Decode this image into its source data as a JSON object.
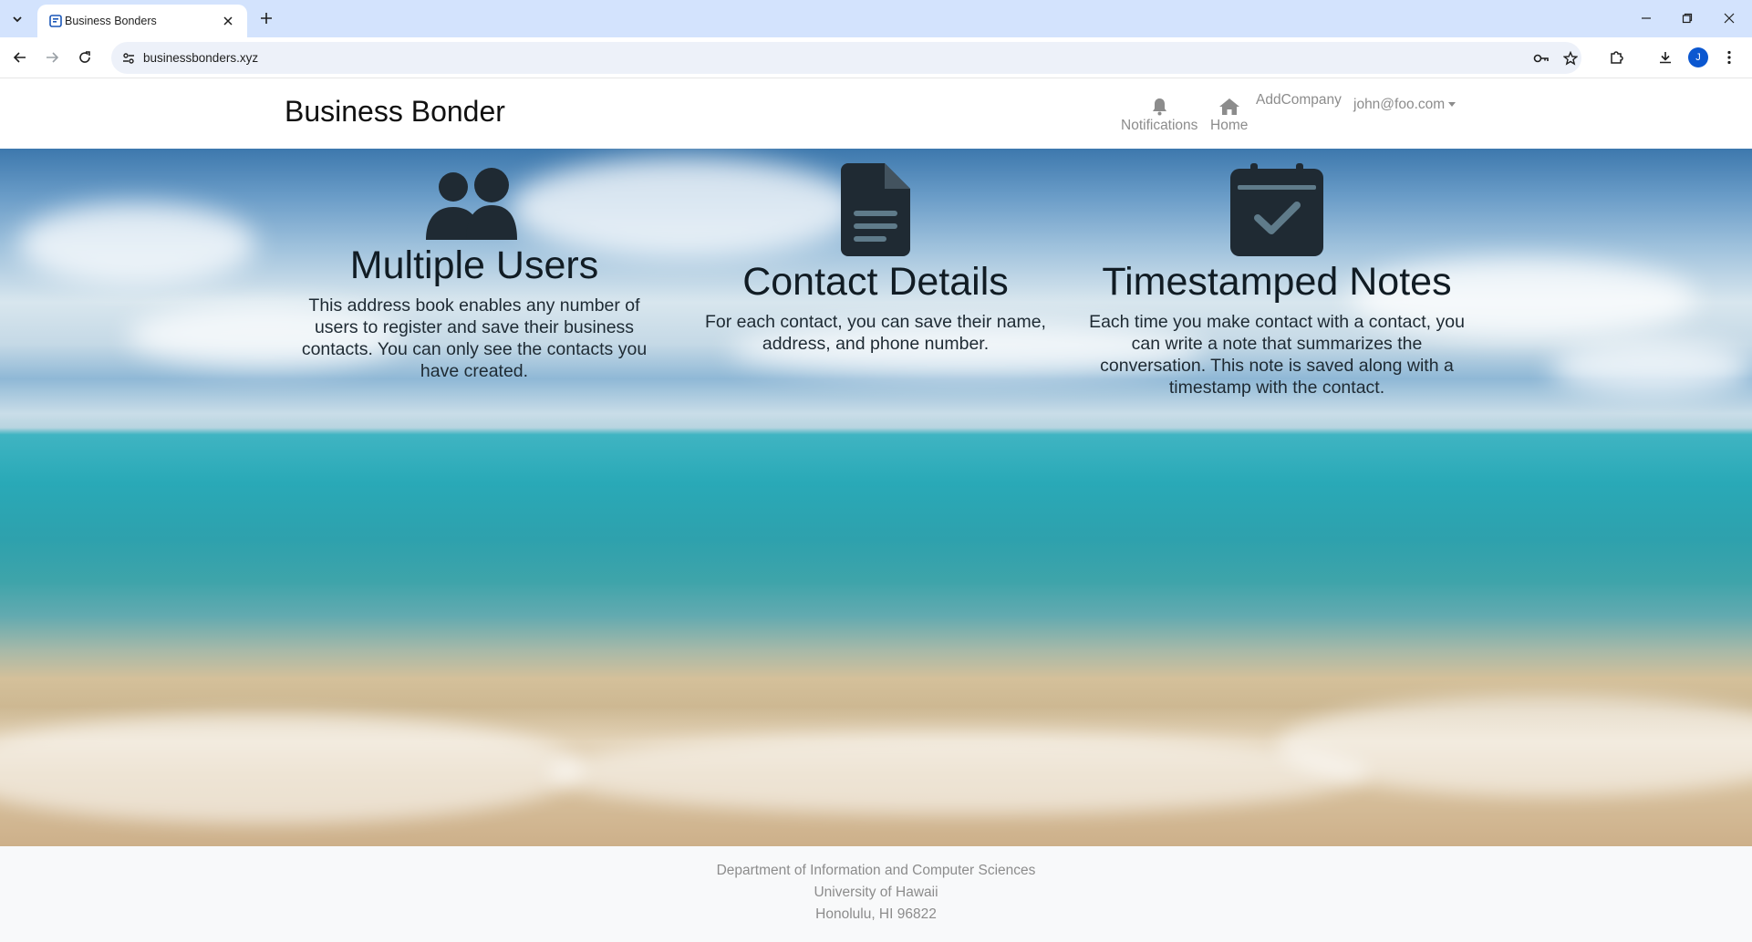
{
  "browser": {
    "tab_title": "Business Bonders",
    "url": "businessbonders.xyz",
    "profile_initial": "J"
  },
  "navbar": {
    "brand": "Business Bonder",
    "notifications_label": "Notifications",
    "home_label": "Home",
    "add_company_label": "AddCompany",
    "user_label": "john@foo.com"
  },
  "features": [
    {
      "icon": "users-icon",
      "title": "Multiple Users",
      "text": "This address book enables any number of users to register and save their business contacts. You can only see the contacts you have created."
    },
    {
      "icon": "file-document-icon",
      "title": "Contact Details",
      "text": "For each contact, you can save their name, address, and phone number."
    },
    {
      "icon": "calendar-check-icon",
      "title": "Timestamped Notes",
      "text": "Each time you make contact with a contact, you can write a note that summarizes the conversation. This note is saved along with a timestamp with the contact."
    }
  ],
  "footer": {
    "line1": "Department of Information and Computer Sciences",
    "line2": "University of Hawaii",
    "line3": "Honolulu, HI 96822"
  },
  "colors": {
    "tabstrip_bg": "#d3e3fd",
    "icon_dark": "#1f2a33",
    "nav_gray": "#8c8c8c",
    "footer_bg": "#f8f9fa"
  }
}
